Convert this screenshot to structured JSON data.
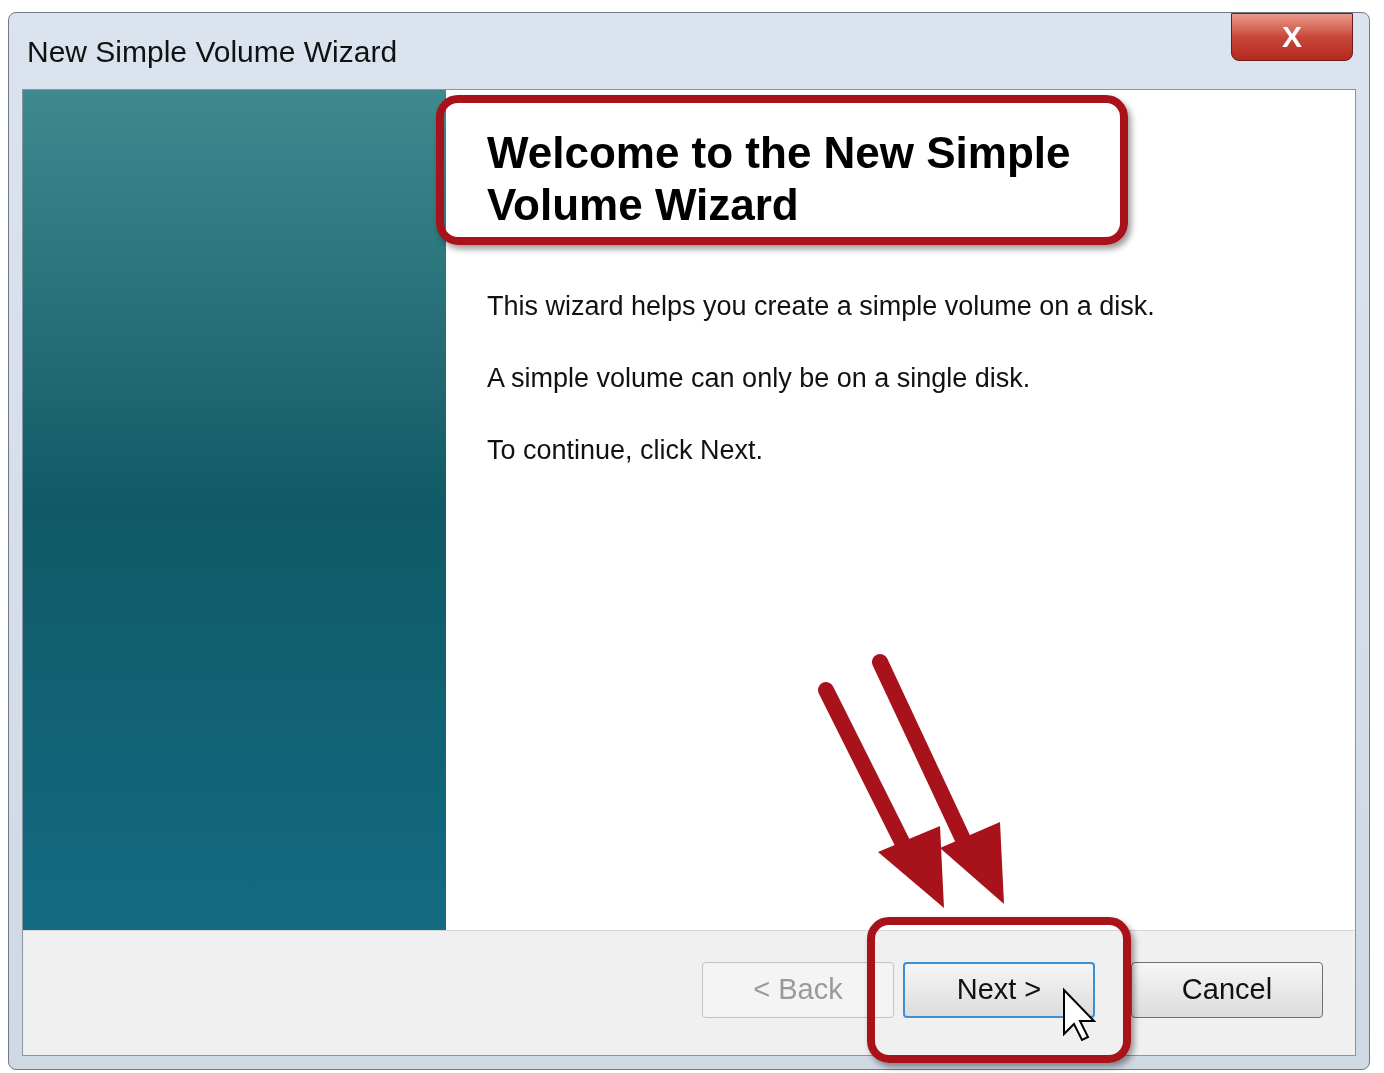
{
  "window": {
    "title": "New Simple Volume Wizard",
    "close_label": "X"
  },
  "heading": "Welcome to the New Simple Volume Wizard",
  "paragraphs": [
    "This wizard helps you create a simple volume on a disk.",
    "A simple volume can only be on a single disk.",
    "To continue, click Next."
  ],
  "buttons": [
    {
      "label": "< Back",
      "disabled": true,
      "default": false
    },
    {
      "label": "Next >",
      "disabled": false,
      "default": true
    },
    {
      "label": "Cancel",
      "disabled": false,
      "default": false
    }
  ]
}
